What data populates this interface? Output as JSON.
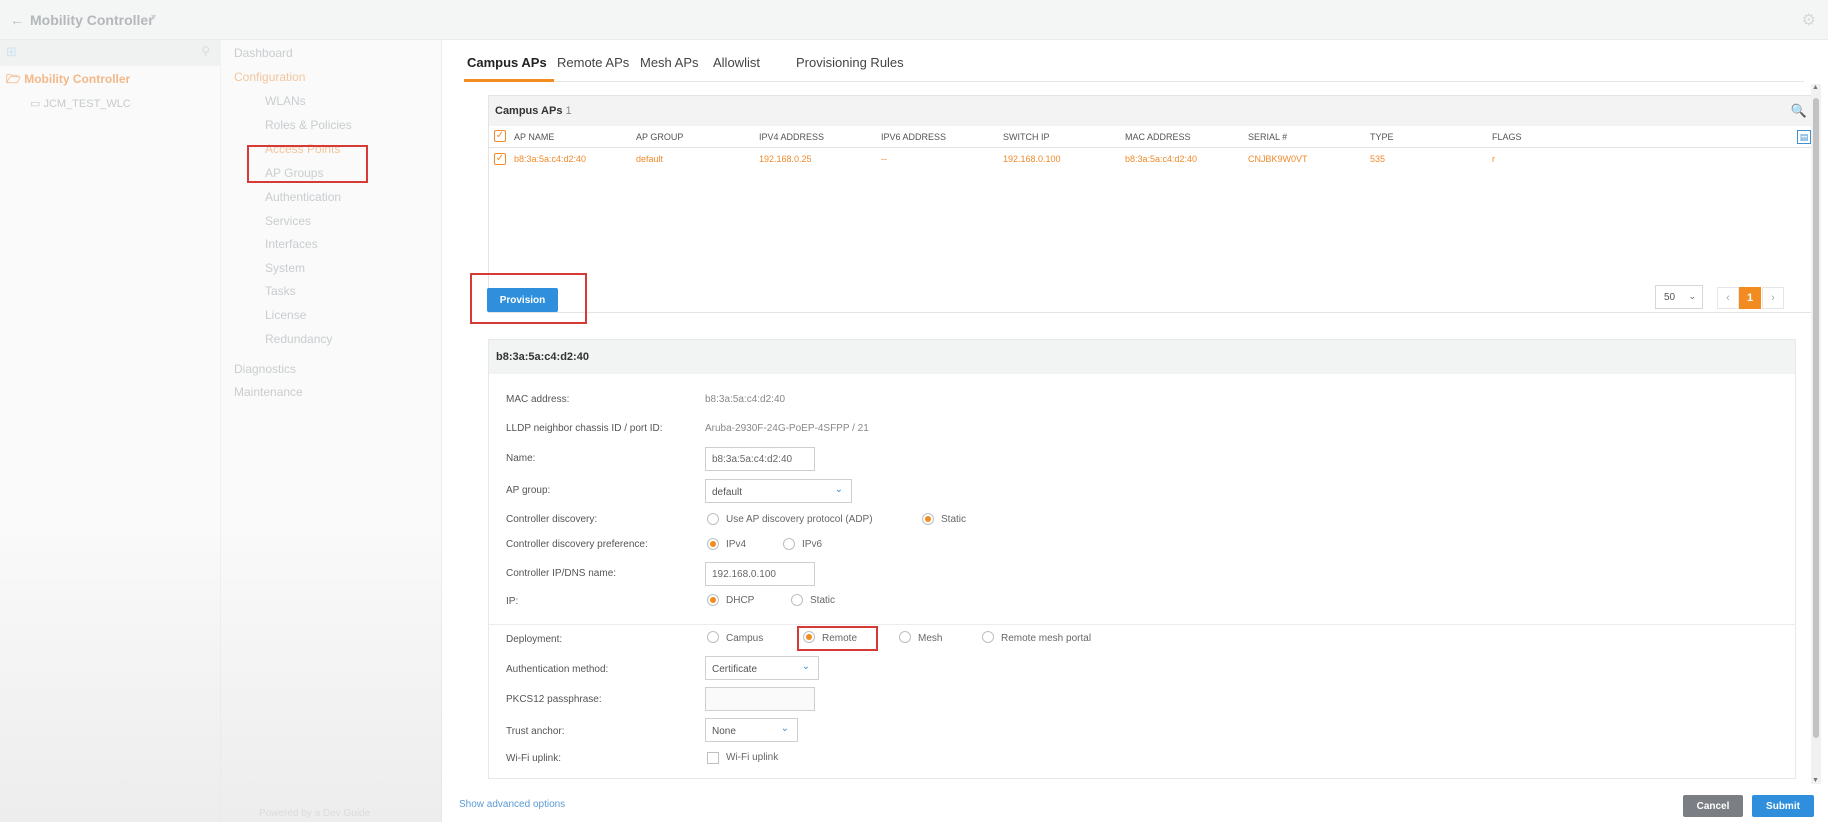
{
  "topbar": {
    "back_icon": "arrow-left-icon",
    "title": "Mobility Controller",
    "caret": "▾"
  },
  "tree": {
    "root": "Mobility Controller",
    "child": "JCM_TEST_WLC"
  },
  "nav": {
    "items": [
      "Dashboard",
      "Configuration",
      "WLANs",
      "Roles & Policies",
      "Access Points",
      "AP Groups",
      "Authentication",
      "Services",
      "Interfaces",
      "System",
      "Tasks",
      "License",
      "Redundancy",
      "Diagnostics",
      "Maintenance"
    ],
    "footer": "Powered by a Dev Guide"
  },
  "tabs": [
    "Campus APs",
    "Remote APs",
    "Mesh APs",
    "Allowlist",
    "Provisioning Rules"
  ],
  "table": {
    "title": "Campus APs",
    "count": "1",
    "columns": [
      "AP NAME",
      "AP GROUP",
      "IPV4 ADDRESS",
      "IPV6 ADDRESS",
      "SWITCH IP",
      "MAC ADDRESS",
      "SERIAL #",
      "TYPE",
      "FLAGS"
    ],
    "rows": [
      [
        "b8:3a:5a:c4:d2:40",
        "default",
        "192.168.0.25",
        "--",
        "192.168.0.100",
        "b8:3a:5a:c4:d2:40",
        "CNJBK9W0VT",
        "535",
        "r"
      ]
    ]
  },
  "buttons": {
    "provision": "Provision",
    "cancel": "Cancel",
    "submit": "Submit"
  },
  "pager": {
    "size": "50",
    "current": "1",
    "prev": "‹",
    "next": "›"
  },
  "detail": {
    "title": "b8:3a:5a:c4:d2:40",
    "labels": {
      "mac": "MAC address:",
      "lldp": "LLDP neighbor chassis ID / port ID:",
      "name": "Name:",
      "ap_group": "AP group:",
      "ctrl_disc": "Controller discovery:",
      "ctrl_pref": "Controller discovery preference:",
      "ctrl_ip": "Controller IP/DNS name:",
      "ip": "IP:",
      "deployment": "Deployment:",
      "auth": "Authentication method:",
      "pkcs": "PKCS12 passphrase:",
      "trust": "Trust anchor:",
      "wifi_uplink": "Wi-Fi uplink:"
    },
    "values": {
      "mac": "b8:3a:5a:c4:d2:40",
      "lldp": "Aruba-2930F-24G-PoEP-4SFPP / 21",
      "name": "b8:3a:5a:c4:d2:40",
      "ap_group": "default",
      "ctrl_ip": "192.168.0.100",
      "auth": "Certificate",
      "pkcs": "",
      "trust": "None"
    },
    "options": {
      "ctrl_disc": [
        "Use AP discovery protocol (ADP)",
        "Static"
      ],
      "ctrl_pref": [
        "IPv4",
        "IPv6"
      ],
      "ip": [
        "DHCP",
        "Static"
      ],
      "deployment": [
        "Campus",
        "Remote",
        "Mesh",
        "Remote mesh portal"
      ],
      "wifi_uplink": "Wi-Fi uplink"
    },
    "selected": {
      "ctrl_disc": "Static",
      "ctrl_pref": "IPv4",
      "ip": "DHCP",
      "deployment": "Remote"
    }
  },
  "advanced_link": "Show advanced options",
  "colors": {
    "accent": "#f28b20",
    "primary": "#2f8fdc",
    "highlight": "#d53b34"
  }
}
